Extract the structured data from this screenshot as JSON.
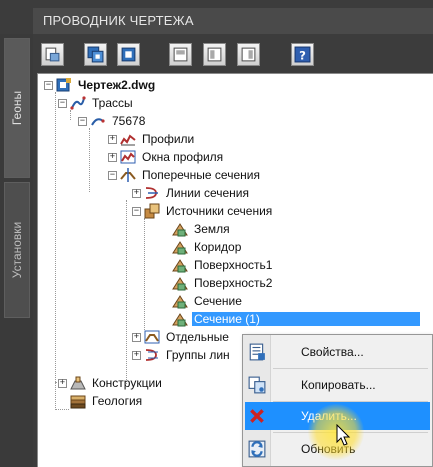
{
  "panel": {
    "title": "ПРОВОДНИК ЧЕРТЕЖА",
    "side_tabs": [
      "Геоны",
      "Установки"
    ]
  },
  "toolbar": {
    "buttons": [
      "toggle-mode-icon",
      "tree-view-icon",
      "item-view-icon",
      "panel-bottom-icon",
      "panel-right-icon",
      "panel-split-icon",
      "help-icon"
    ]
  },
  "tree": {
    "root": "Чертеж2.dwg",
    "alignments": "Трассы",
    "alignment_name": "75678",
    "profiles": "Профили",
    "profile_views": "Окна профиля",
    "sections": "Поперечные сечения",
    "sample_lines": "Линии сечения",
    "section_sources": "Источники сечения",
    "sources": [
      "Земля",
      "Коридор",
      "Поверхность1",
      "Поверхность2",
      "Сечение",
      "Сечение (1)"
    ],
    "section_views": "Отдельные",
    "section_view_groups": "Группы лин",
    "assemblies": "Конструкции",
    "geology": "Геология"
  },
  "context_menu": {
    "items": [
      "Свойства...",
      "Копировать...",
      "Удалить...",
      "Обновить"
    ]
  }
}
